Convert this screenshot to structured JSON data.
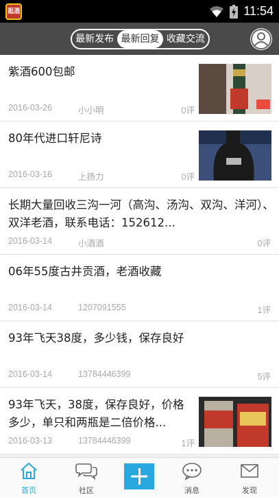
{
  "status_bar": {
    "time": "11:54",
    "app_icon_text": "逛酒"
  },
  "header": {
    "tabs": [
      "最新发布",
      "最新回复",
      "收藏交流"
    ],
    "active_tab": 1
  },
  "posts": [
    {
      "title": "紫酒600包邮",
      "date": "2016-03-26",
      "user": "小小明",
      "replies": "0评",
      "has_thumb": true
    },
    {
      "title": "80年代进口轩尼诗",
      "date": "2016-03-16",
      "user": "上扬力",
      "replies": "0评",
      "has_thumb": true
    },
    {
      "title": "长期大量回收三沟一河（高沟、汤沟、双沟、洋河）、双洋老酒，联系电话：152612...",
      "date": "2016-03-14",
      "user": "小酒酒",
      "replies": "0评",
      "has_thumb": false
    },
    {
      "title": "06年55度古井贡酒，老酒收藏",
      "date": "2016-03-14",
      "user": "1207091555",
      "replies": "1评",
      "has_thumb": false
    },
    {
      "title": "93年飞天38度，多少钱，保存良好",
      "date": "2016-03-14",
      "user": "13784446399",
      "replies": "5评",
      "has_thumb": false
    },
    {
      "title": "93年飞天，38度，保存良好，价格多少，单只和两瓶是二倍价格...",
      "date": "2016-03-13",
      "user": "13784446399",
      "replies": "1评",
      "has_thumb": true
    }
  ],
  "bottom_nav": [
    {
      "label": "首页",
      "icon": "home-icon",
      "active": true
    },
    {
      "label": "社区",
      "icon": "chat-bubbles-icon",
      "active": false
    },
    {
      "label": "",
      "icon": "plus-icon",
      "active": false
    },
    {
      "label": "消息",
      "icon": "message-icon",
      "active": false
    },
    {
      "label": "发现",
      "icon": "discover-icon",
      "active": false
    }
  ],
  "colors": {
    "accent": "#29a8e0",
    "header_bg": "#4a4a4a",
    "status_bg": "#000000"
  }
}
